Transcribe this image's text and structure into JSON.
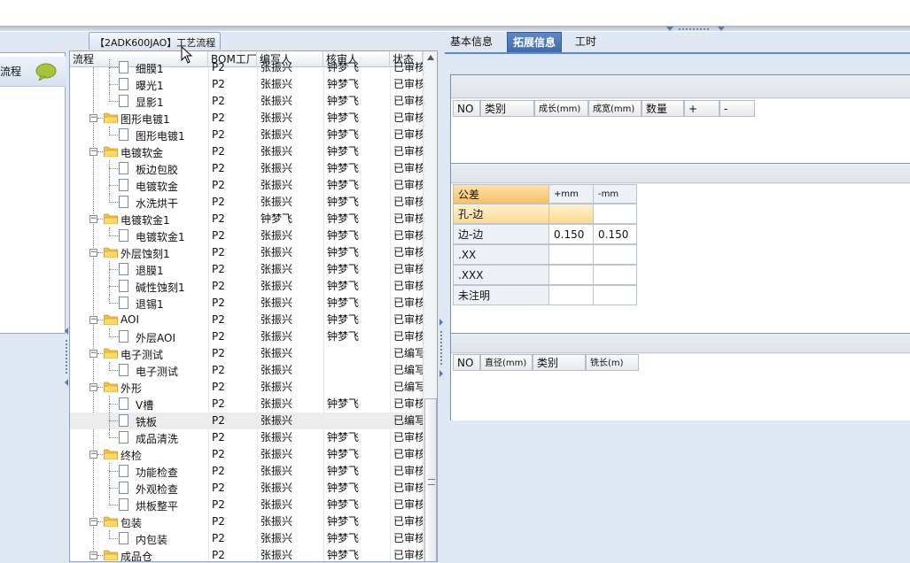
{
  "window": {
    "doc_tab_title": "【2ADK600JAO】工艺流程",
    "nav_item_label": "流程"
  },
  "grid": {
    "columns": [
      "流程",
      "BOM工厂",
      "编写人",
      "核审人",
      "状态"
    ],
    "rows": [
      {
        "level": 2,
        "type": "leaf",
        "name": "细膜1",
        "bom": "P2",
        "writer": "张振兴",
        "reviewer": "钟梦飞",
        "status": "已审核"
      },
      {
        "level": 2,
        "type": "leaf",
        "name": "曝光1",
        "bom": "P2",
        "writer": "张振兴",
        "reviewer": "钟梦飞",
        "status": "已审核"
      },
      {
        "level": 2,
        "type": "leaf",
        "name": "显影1",
        "bom": "P2",
        "writer": "张振兴",
        "reviewer": "钟梦飞",
        "status": "已审核"
      },
      {
        "level": 1,
        "type": "folder",
        "name": "图形电镀1",
        "bom": "P2",
        "writer": "张振兴",
        "reviewer": "钟梦飞",
        "status": "已审核"
      },
      {
        "level": 2,
        "type": "leaf",
        "name": "图形电镀1",
        "bom": "P2",
        "writer": "张振兴",
        "reviewer": "钟梦飞",
        "status": "已审核"
      },
      {
        "level": 1,
        "type": "folder",
        "name": "电镀软金",
        "bom": "P2",
        "writer": "张振兴",
        "reviewer": "钟梦飞",
        "status": "已审核"
      },
      {
        "level": 2,
        "type": "leaf",
        "name": "板边包胶",
        "bom": "P2",
        "writer": "张振兴",
        "reviewer": "钟梦飞",
        "status": "已审核"
      },
      {
        "level": 2,
        "type": "leaf",
        "name": "电镀软金",
        "bom": "P2",
        "writer": "张振兴",
        "reviewer": "钟梦飞",
        "status": "已审核"
      },
      {
        "level": 2,
        "type": "leaf",
        "name": "水洗烘干",
        "bom": "P2",
        "writer": "张振兴",
        "reviewer": "钟梦飞",
        "status": "已审核"
      },
      {
        "level": 1,
        "type": "folder",
        "name": "电镀软金1",
        "bom": "P2",
        "writer": "钟梦飞",
        "reviewer": "钟梦飞",
        "status": "已审核"
      },
      {
        "level": 2,
        "type": "leaf",
        "name": "电镀软金1",
        "bom": "P2",
        "writer": "张振兴",
        "reviewer": "钟梦飞",
        "status": "已审核"
      },
      {
        "level": 1,
        "type": "folder",
        "name": "外层蚀刻1",
        "bom": "P2",
        "writer": "张振兴",
        "reviewer": "钟梦飞",
        "status": "已审核"
      },
      {
        "level": 2,
        "type": "leaf",
        "name": "退膜1",
        "bom": "P2",
        "writer": "张振兴",
        "reviewer": "钟梦飞",
        "status": "已审核"
      },
      {
        "level": 2,
        "type": "leaf",
        "name": "碱性蚀刻1",
        "bom": "P2",
        "writer": "张振兴",
        "reviewer": "钟梦飞",
        "status": "已审核"
      },
      {
        "level": 2,
        "type": "leaf",
        "name": "退锡1",
        "bom": "P2",
        "writer": "张振兴",
        "reviewer": "钟梦飞",
        "status": "已审核"
      },
      {
        "level": 1,
        "type": "folder",
        "name": "AOI",
        "bom": "P2",
        "writer": "张振兴",
        "reviewer": "钟梦飞",
        "status": "已审核"
      },
      {
        "level": 2,
        "type": "leaf",
        "name": "外层AOI",
        "bom": "P2",
        "writer": "张振兴",
        "reviewer": "钟梦飞",
        "status": "已审核"
      },
      {
        "level": 1,
        "type": "folder",
        "name": "电子测试",
        "bom": "P2",
        "writer": "张振兴",
        "reviewer": "",
        "status": "已编写"
      },
      {
        "level": 2,
        "type": "leaf",
        "name": "电子测试",
        "bom": "P2",
        "writer": "张振兴",
        "reviewer": "",
        "status": "已编写"
      },
      {
        "level": 1,
        "type": "folder",
        "name": "外形",
        "bom": "P2",
        "writer": "张振兴",
        "reviewer": "",
        "status": "已编写"
      },
      {
        "level": 2,
        "type": "leaf",
        "name": "V槽",
        "bom": "P2",
        "writer": "张振兴",
        "reviewer": "钟梦飞",
        "status": "已审核"
      },
      {
        "level": 2,
        "type": "leaf",
        "name": "铣板",
        "bom": "P2",
        "writer": "张振兴",
        "reviewer": "",
        "status": "已编写",
        "selected": true
      },
      {
        "level": 2,
        "type": "leaf",
        "name": "成品清洗",
        "bom": "P2",
        "writer": "张振兴",
        "reviewer": "钟梦飞",
        "status": "已审核"
      },
      {
        "level": 1,
        "type": "folder",
        "name": "终检",
        "bom": "P2",
        "writer": "张振兴",
        "reviewer": "钟梦飞",
        "status": "已审核"
      },
      {
        "level": 2,
        "type": "leaf",
        "name": "功能检查",
        "bom": "P2",
        "writer": "张振兴",
        "reviewer": "钟梦飞",
        "status": "已审核"
      },
      {
        "level": 2,
        "type": "leaf",
        "name": "外观检查",
        "bom": "P2",
        "writer": "张振兴",
        "reviewer": "钟梦飞",
        "status": "已审核"
      },
      {
        "level": 2,
        "type": "leaf",
        "name": "烘板整平",
        "bom": "P2",
        "writer": "张振兴",
        "reviewer": "钟梦飞",
        "status": "已审核"
      },
      {
        "level": 1,
        "type": "folder",
        "name": "包装",
        "bom": "P2",
        "writer": "张振兴",
        "reviewer": "钟梦飞",
        "status": "已审核"
      },
      {
        "level": 2,
        "type": "leaf",
        "name": "内包装",
        "bom": "P2",
        "writer": "张振兴",
        "reviewer": "钟梦飞",
        "status": "已审核"
      },
      {
        "level": 1,
        "type": "folder",
        "name": "成品仓",
        "bom": "P2",
        "writer": "张振兴",
        "reviewer": "钟梦飞",
        "status": "已审核"
      }
    ]
  },
  "right": {
    "tabs": [
      {
        "label": "基本信息",
        "active": false
      },
      {
        "label": "拓展信息",
        "active": true
      },
      {
        "label": "工时",
        "active": false
      }
    ],
    "table1": {
      "headers": [
        "NO",
        "类别",
        "成长(mm)",
        "成宽(mm)",
        "数量",
        "+",
        "-"
      ]
    },
    "tolerance": {
      "headers": [
        "公差",
        "+mm",
        "-mm"
      ],
      "rows": [
        {
          "label": "孔-边",
          "plus": "",
          "minus": ""
        },
        {
          "label": "边-边",
          "plus": "0.150",
          "minus": "0.150"
        },
        {
          "label": ".XX",
          "plus": "",
          "minus": ""
        },
        {
          "label": ".XXX",
          "plus": "",
          "minus": ""
        },
        {
          "label": "未注明",
          "plus": "",
          "minus": ""
        }
      ]
    },
    "table3": {
      "headers": [
        "NO",
        "直径(mm)",
        "类别",
        "铣长(m)"
      ]
    }
  },
  "colors": {
    "accent": "#4a74b6",
    "selection": "#ececec",
    "orange": "#f7c26a"
  }
}
